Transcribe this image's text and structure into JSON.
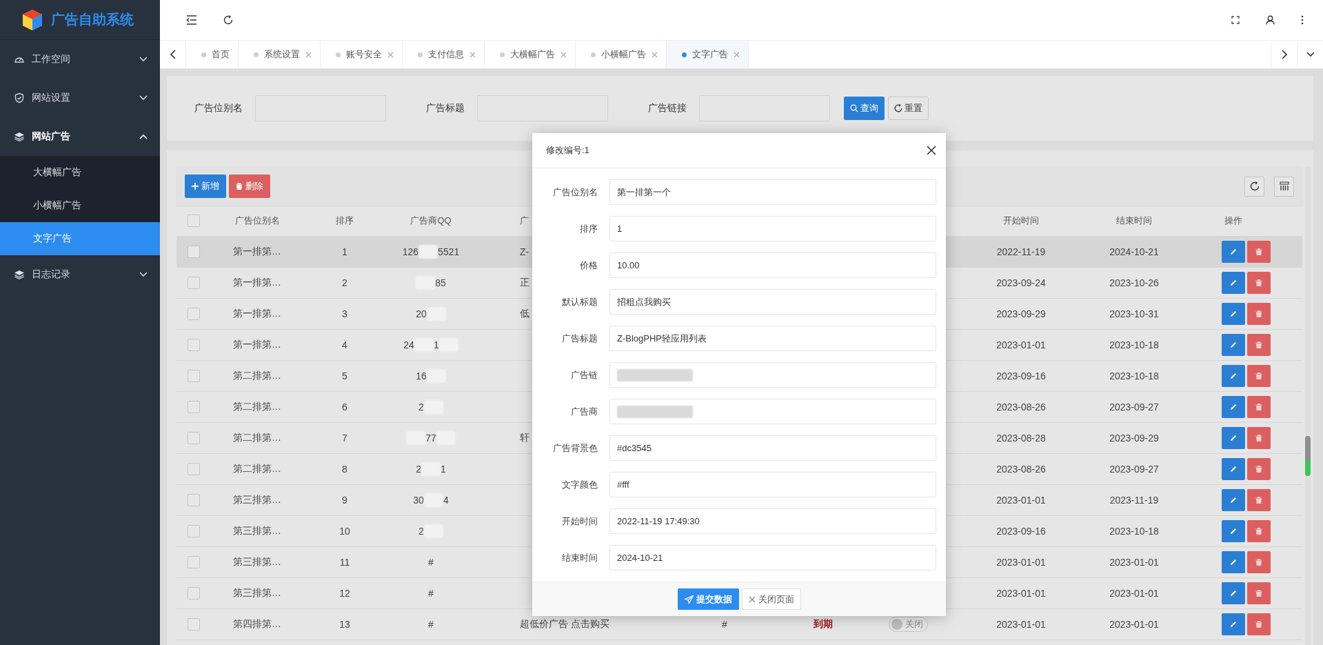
{
  "app": {
    "title": "广告自助系统"
  },
  "sidebar": {
    "items": [
      {
        "label": "工作空间",
        "kind": "dashboard",
        "expanded": false
      },
      {
        "label": "网站设置",
        "kind": "shield",
        "expanded": false
      },
      {
        "label": "网站广告",
        "kind": "layers",
        "expanded": true,
        "children": [
          {
            "label": "大横幅广告",
            "selected": false
          },
          {
            "label": "小横幅广告",
            "selected": false
          },
          {
            "label": "文字广告",
            "selected": true
          }
        ]
      },
      {
        "label": "日志记录",
        "kind": "layers",
        "expanded": false
      }
    ]
  },
  "tabs": [
    {
      "label": "首页",
      "selected": false,
      "closable": false
    },
    {
      "label": "系统设置",
      "selected": false,
      "closable": true
    },
    {
      "label": "账号安全",
      "selected": false,
      "closable": true
    },
    {
      "label": "支付信息",
      "selected": false,
      "closable": true
    },
    {
      "label": "大横幅广告",
      "selected": false,
      "closable": true
    },
    {
      "label": "小横幅广告",
      "selected": false,
      "closable": true
    },
    {
      "label": "文字广告",
      "selected": true,
      "closable": true
    }
  ],
  "search": {
    "fields": [
      {
        "label": "广告位别名"
      },
      {
        "label": "广告标题"
      },
      {
        "label": "广告链接"
      }
    ],
    "buttons": [
      {
        "label": "查询",
        "kind": "search"
      },
      {
        "label": "重置",
        "kind": "reset"
      }
    ]
  },
  "toolbar": {
    "buttons": [
      {
        "label": "新增",
        "kind": "add"
      },
      {
        "label": "删除",
        "kind": "delete"
      }
    ]
  },
  "table": {
    "columns": [
      {
        "kind": "checkbox",
        "checked": false
      },
      {
        "label": "广告位别名"
      },
      {
        "label": "排序"
      },
      {
        "label": "广告商QQ"
      },
      {
        "label": "广"
      },
      {
        "label": "开始时间"
      },
      {
        "label": "结束时间"
      },
      {
        "label": "操作"
      }
    ],
    "rows": [
      {
        "checked": false,
        "highlighted": true,
        "name": "第一排第…",
        "order": "1",
        "qq": [
          {
            "kind": "text",
            "text": "126"
          },
          {
            "kind": "redacted"
          },
          {
            "kind": "text",
            "text": "5521"
          }
        ],
        "title": "Z-",
        "start": "2022-11-19",
        "end": "2024-10-21"
      },
      {
        "checked": false,
        "highlighted": false,
        "name": "第一排第…",
        "order": "2",
        "qq": [
          {
            "kind": "redacted"
          },
          {
            "kind": "text",
            "text": "85"
          }
        ],
        "title": "正",
        "start": "2023-09-24",
        "end": "2023-10-26"
      },
      {
        "checked": false,
        "highlighted": false,
        "name": "第一排第…",
        "order": "3",
        "qq": [
          {
            "kind": "text",
            "text": "20"
          },
          {
            "kind": "redacted"
          }
        ],
        "title": "低",
        "start": "2023-09-29",
        "end": "2023-10-31"
      },
      {
        "checked": false,
        "highlighted": false,
        "name": "第一排第…",
        "order": "4",
        "qq": [
          {
            "kind": "text",
            "text": "24"
          },
          {
            "kind": "redacted"
          },
          {
            "kind": "text",
            "text": "1"
          },
          {
            "kind": "redacted"
          }
        ],
        "start": "2023-01-01",
        "end": "2023-10-18"
      },
      {
        "checked": false,
        "highlighted": false,
        "name": "第二排第…",
        "order": "5",
        "qq": [
          {
            "kind": "text",
            "text": "16"
          },
          {
            "kind": "redacted"
          }
        ],
        "start": "2023-09-16",
        "end": "2023-10-18"
      },
      {
        "checked": false,
        "highlighted": false,
        "name": "第二排第…",
        "order": "6",
        "qq": [
          {
            "kind": "text",
            "text": "2"
          },
          {
            "kind": "redacted"
          }
        ],
        "start": "2023-08-26",
        "end": "2023-09-27"
      },
      {
        "checked": false,
        "highlighted": false,
        "name": "第二排第…",
        "order": "7",
        "qq": [
          {
            "kind": "redacted"
          },
          {
            "kind": "text",
            "text": "77"
          },
          {
            "kind": "redacted"
          }
        ],
        "title": "轩",
        "start": "2023-08-28",
        "end": "2023-09-29"
      },
      {
        "checked": false,
        "highlighted": false,
        "name": "第二排第…",
        "order": "8",
        "qq": [
          {
            "kind": "text",
            "text": "2"
          },
          {
            "kind": "redacted"
          },
          {
            "kind": "text",
            "text": "1"
          }
        ],
        "start": "2023-08-26",
        "end": "2023-09-27"
      },
      {
        "checked": false,
        "highlighted": false,
        "name": "第三排第…",
        "order": "9",
        "qq": [
          {
            "kind": "text",
            "text": "30"
          },
          {
            "kind": "redacted"
          },
          {
            "kind": "text",
            "text": "4"
          }
        ],
        "start": "2023-01-01",
        "end": "2023-11-19"
      },
      {
        "checked": false,
        "highlighted": false,
        "name": "第三排第…",
        "order": "10",
        "qq": [
          {
            "kind": "text",
            "text": "2"
          },
          {
            "kind": "redacted"
          }
        ],
        "start": "2023-09-16",
        "end": "2023-10-18"
      },
      {
        "checked": false,
        "highlighted": false,
        "name": "第三排第…",
        "order": "11",
        "qq": [
          {
            "kind": "text",
            "text": "#"
          }
        ],
        "start": "2023-01-01",
        "end": "2023-01-01"
      },
      {
        "checked": false,
        "highlighted": false,
        "name": "第三排第…",
        "order": "12",
        "qq": [
          {
            "kind": "text",
            "text": "#"
          }
        ],
        "start": "2023-01-01",
        "end": "2023-01-01"
      },
      {
        "checked": false,
        "highlighted": false,
        "name": "第四排第…",
        "order": "13",
        "qq": [
          {
            "kind": "text",
            "text": "#"
          }
        ],
        "title": "超低价广告 点击购买",
        "link": "#",
        "status": "到期",
        "switch": {
          "on": false,
          "label": "关闭"
        },
        "start": "2023-01-01",
        "end": "2023-01-01"
      }
    ]
  },
  "dialog": {
    "title": "修改编号:1",
    "fields": [
      {
        "label": "广告位别名",
        "value": "第一排第一个"
      },
      {
        "label": "排序",
        "value": "1"
      },
      {
        "label": "价格",
        "value": "10.00"
      },
      {
        "label": "默认标题",
        "value": "招租点我购买"
      },
      {
        "label": "广告标题",
        "value": "Z-BlogPHP轻应用列表"
      },
      {
        "label": "广告链",
        "redacted": true
      },
      {
        "label": "广告商",
        "redacted": true
      },
      {
        "label": "广告背景色",
        "value": "#dc3545"
      },
      {
        "label": "文字颜色",
        "value": "#fff"
      },
      {
        "label": "开始时间",
        "value": "2022-11-19 17:49:30"
      },
      {
        "label": "结束时间",
        "value": "2024-10-21"
      }
    ],
    "buttons": [
      {
        "label": "提交数据",
        "kind": "submit"
      },
      {
        "label": "关闭页面",
        "kind": "close"
      }
    ]
  }
}
